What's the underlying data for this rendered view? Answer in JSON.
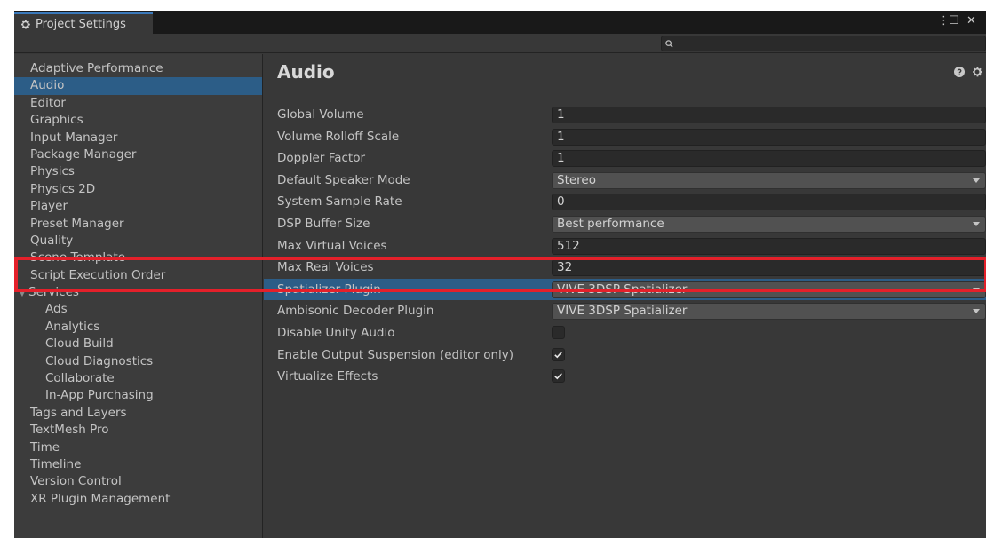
{
  "window": {
    "tab_title": "Project Settings",
    "menu_glyph": "⋮",
    "maximize_glyph": "☐",
    "close_glyph": "✕"
  },
  "search": {
    "placeholder": "",
    "value": ""
  },
  "sidebar": {
    "items": [
      {
        "label": "Adaptive Performance",
        "level": 0
      },
      {
        "label": "Audio",
        "level": 0,
        "selected": true
      },
      {
        "label": "Editor",
        "level": 0
      },
      {
        "label": "Graphics",
        "level": 0
      },
      {
        "label": "Input Manager",
        "level": 0
      },
      {
        "label": "Package Manager",
        "level": 0
      },
      {
        "label": "Physics",
        "level": 0
      },
      {
        "label": "Physics 2D",
        "level": 0
      },
      {
        "label": "Player",
        "level": 0
      },
      {
        "label": "Preset Manager",
        "level": 0
      },
      {
        "label": "Quality",
        "level": 0
      },
      {
        "label": "Scene Template",
        "level": 0
      },
      {
        "label": "Script Execution Order",
        "level": 0
      },
      {
        "label": "Services",
        "level": 0,
        "expanded": true
      },
      {
        "label": "Ads",
        "level": 1
      },
      {
        "label": "Analytics",
        "level": 1
      },
      {
        "label": "Cloud Build",
        "level": 1
      },
      {
        "label": "Cloud Diagnostics",
        "level": 1
      },
      {
        "label": "Collaborate",
        "level": 1
      },
      {
        "label": "In-App Purchasing",
        "level": 1
      },
      {
        "label": "Tags and Layers",
        "level": 0
      },
      {
        "label": "TextMesh Pro",
        "level": 0
      },
      {
        "label": "Time",
        "level": 0
      },
      {
        "label": "Timeline",
        "level": 0
      },
      {
        "label": "Version Control",
        "level": 0
      },
      {
        "label": "XR Plugin Management",
        "level": 0
      }
    ]
  },
  "main": {
    "title": "Audio",
    "settings": [
      {
        "label": "Global Volume",
        "type": "number",
        "value": "1"
      },
      {
        "label": "Volume Rolloff Scale",
        "type": "number",
        "value": "1"
      },
      {
        "label": "Doppler Factor",
        "type": "number",
        "value": "1"
      },
      {
        "label": "Default Speaker Mode",
        "type": "dropdown",
        "value": "Stereo"
      },
      {
        "label": "System Sample Rate",
        "type": "number",
        "value": "0"
      },
      {
        "label": "DSP Buffer Size",
        "type": "dropdown",
        "value": "Best performance"
      },
      {
        "label": "Max Virtual Voices",
        "type": "number",
        "value": "512"
      },
      {
        "label": "Max Real Voices",
        "type": "number",
        "value": "32"
      },
      {
        "label": "Spatializer Plugin",
        "type": "dropdown",
        "value": "VIVE 3DSP Spatializer",
        "highlighted": true
      },
      {
        "label": "Ambisonic Decoder Plugin",
        "type": "dropdown",
        "value": "VIVE 3DSP Spatializer"
      },
      {
        "label": "Disable Unity Audio",
        "type": "checkbox",
        "checked": false
      },
      {
        "label": "Enable Output Suspension (editor only)",
        "type": "checkbox",
        "checked": true
      },
      {
        "label": "Virtualize Effects",
        "type": "checkbox",
        "checked": true
      }
    ]
  },
  "colors": {
    "window_bg": "#383838",
    "sidebar_bg": "#3c3c3c",
    "selected_bg": "#2c5d87",
    "highlight_row_bg": "#2c5d87",
    "annotation_red": "#e4202a",
    "tab_accent": "#3a79bb"
  }
}
